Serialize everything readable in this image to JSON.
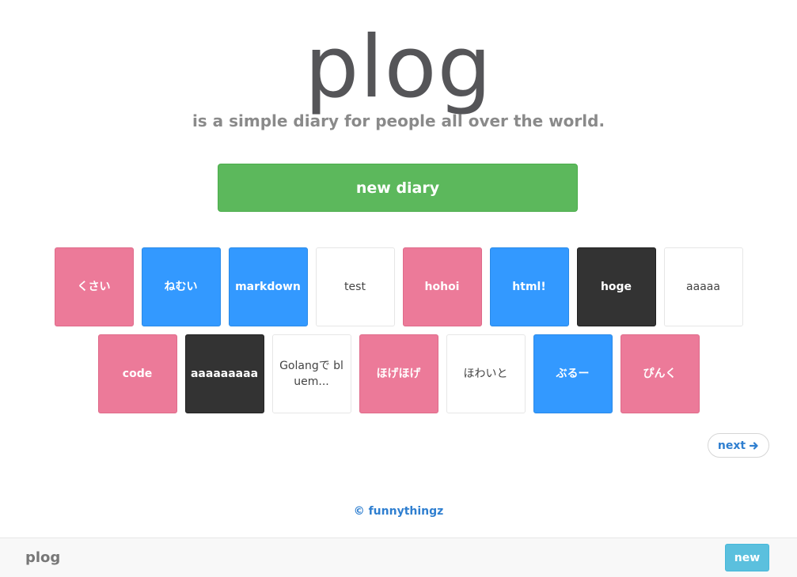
{
  "header": {
    "title": "plog",
    "subtitle": "is a simple diary for people all over the world."
  },
  "actions": {
    "new_diary_label": "new diary"
  },
  "diaries": {
    "row1": [
      {
        "title": "くさい",
        "color": "pink"
      },
      {
        "title": "ねむい",
        "color": "blue"
      },
      {
        "title": "markdown",
        "color": "blue"
      },
      {
        "title": "test",
        "color": "white"
      },
      {
        "title": "hohoi",
        "color": "pink"
      },
      {
        "title": "html!",
        "color": "blue"
      },
      {
        "title": "hoge",
        "color": "dark"
      },
      {
        "title": "aaaaa",
        "color": "white"
      }
    ],
    "row2": [
      {
        "title": "code",
        "color": "pink"
      },
      {
        "title": "aaaaaaaaa",
        "color": "dark"
      },
      {
        "title": "Golangで bluem...",
        "color": "white"
      },
      {
        "title": "ほげほげ",
        "color": "pink"
      },
      {
        "title": "ほわいと",
        "color": "white"
      },
      {
        "title": "ぶるー",
        "color": "blue"
      },
      {
        "title": "ぴんく",
        "color": "pink"
      }
    ]
  },
  "colors": {
    "pink": "#ec7a99",
    "blue": "#3399ff",
    "dark": "#333333",
    "white": "#ffffff",
    "green": "#5cb85c",
    "info": "#5bc0de",
    "link": "#2f7fd0"
  },
  "pagination": {
    "next_label": "next",
    "next_icon": "arrow-right-icon"
  },
  "footer": {
    "credit": "© funnythingz"
  },
  "navbar": {
    "brand": "plog",
    "new_label": "new"
  }
}
